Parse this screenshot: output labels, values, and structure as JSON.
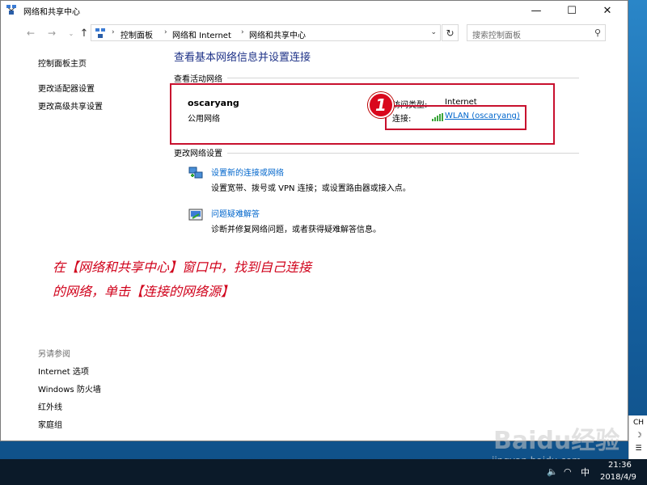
{
  "window": {
    "title": "网络和共享中心",
    "minimize": "—",
    "maximize": "☐",
    "close": "✕"
  },
  "nav": {
    "back": "←",
    "forward": "→",
    "recent": "⌄",
    "up": "↑",
    "breadcrumbs": [
      "控制面板",
      "网络和 Internet",
      "网络和共享中心"
    ],
    "separator": "›",
    "dropdown": "⌄",
    "refresh": "↻",
    "search_placeholder": "搜索控制面板",
    "search_icon": "⚲"
  },
  "sidebar": {
    "links": [
      "控制面板主页",
      "更改适配器设置",
      "更改高级共享设置"
    ],
    "see_also_heading": "另请参阅",
    "see_also": [
      "Internet 选项",
      "Windows 防火墙",
      "红外线",
      "家庭组"
    ]
  },
  "main": {
    "title": "查看基本网络信息并设置连接",
    "active_section": "查看活动网络",
    "network": {
      "name": "oscaryang",
      "type": "公用网络",
      "access_label": "访问类型:",
      "access_value": "Internet",
      "connection_label": "连接:",
      "connection_value": "WLAN (oscaryang)"
    },
    "change_section": "更改网络设置",
    "tasks": [
      {
        "icon": "network-setup-icon",
        "title": "设置新的连接或网络",
        "desc": "设置宽带、拨号或 VPN 连接；或设置路由器或接入点。"
      },
      {
        "icon": "troubleshoot-icon",
        "title": "问题疑难解答",
        "desc": "诊断并修复网络问题，或者获得疑难解答信息。"
      }
    ]
  },
  "annotation": {
    "badge": "1",
    "line1": "在【网络和共享中心】窗口中，找到自己连接",
    "line2": "的网络，单击【连接的网络源】"
  },
  "taskbar": {
    "time": "21:36",
    "date": "2018/4/9",
    "ime": "中",
    "action_items": [
      "CH",
      "☽",
      "☰"
    ]
  },
  "watermark": {
    "brand": "Baidu经验",
    "url": "jingyan.baidu.com"
  },
  "colors": {
    "accent_title": "#1e3287",
    "link": "#0066cc",
    "annotation_red": "#d0021b"
  }
}
